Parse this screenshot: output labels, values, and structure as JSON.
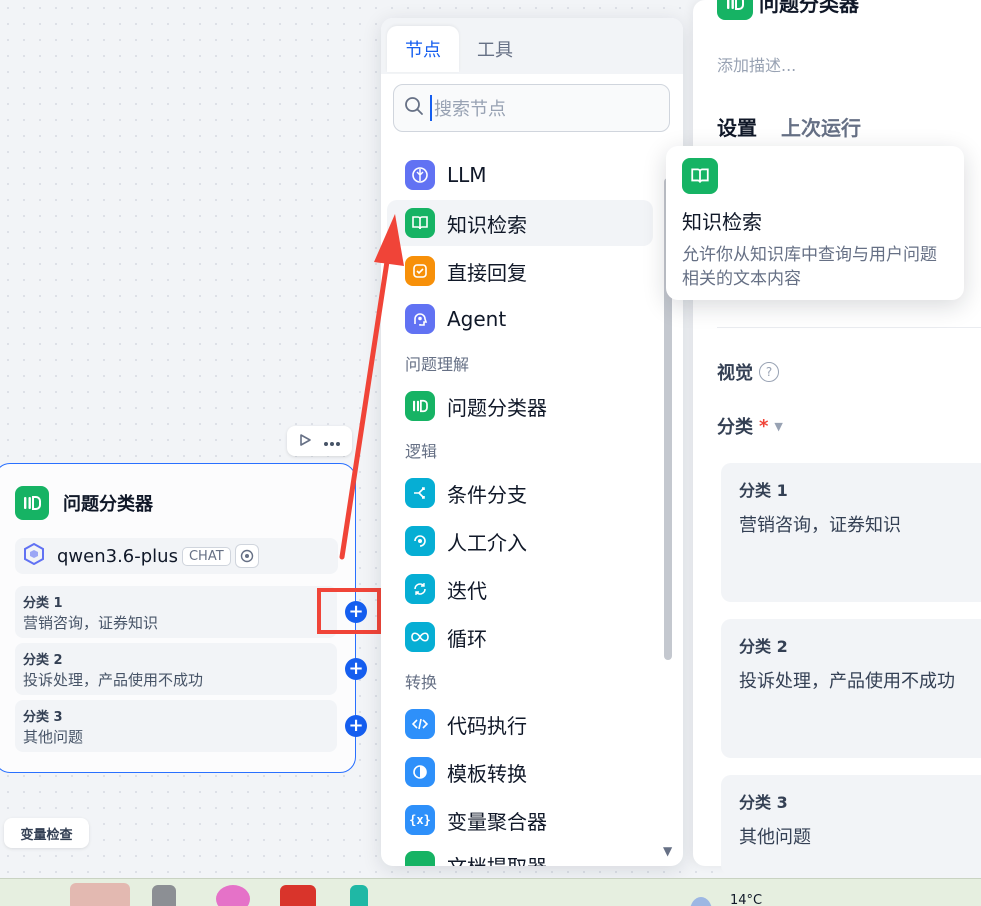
{
  "canvas": {
    "node_actions": {
      "run_icon": "play-icon",
      "more_icon": "more-icon"
    },
    "node": {
      "title": "问题分类器",
      "model": {
        "name": "qwen3.6-plus",
        "mode_badge": "CHAT",
        "vision_icon": "vision-icon"
      },
      "classes": [
        {
          "title": "分类 1",
          "desc": "营销咨询，证券知识"
        },
        {
          "title": "分类 2",
          "desc": "投诉处理，产品使用不成功"
        },
        {
          "title": "分类 3",
          "desc": "其他问题"
        }
      ]
    },
    "variable_check_label": "变量检查"
  },
  "picker": {
    "tabs": [
      {
        "label": "节点",
        "active": true
      },
      {
        "label": "工具",
        "active": false
      }
    ],
    "search_placeholder": "搜索节点",
    "items": [
      {
        "label": "LLM",
        "icon": "llm-icon",
        "color": "#6172f3"
      },
      {
        "label": "知识检索",
        "icon": "book-icon",
        "color": "#16b364",
        "hover": true
      },
      {
        "label": "直接回复",
        "icon": "reply-icon",
        "color": "#f79009"
      },
      {
        "label": "Agent",
        "icon": "agent-icon",
        "color": "#6172f3"
      }
    ],
    "group_understand": "问题理解",
    "classifier_item": {
      "label": "问题分类器",
      "color": "#16b364"
    },
    "group_logic": "逻辑",
    "logic_items": [
      {
        "label": "条件分支",
        "color": "#06aed4"
      },
      {
        "label": "人工介入",
        "color": "#06aed4"
      },
      {
        "label": "迭代",
        "color": "#06aed4"
      },
      {
        "label": "循环",
        "color": "#06aed4"
      }
    ],
    "group_transform": "转换",
    "transform_items": [
      {
        "label": "代码执行",
        "color": "#2e90fa"
      },
      {
        "label": "模板转换",
        "color": "#2e90fa"
      },
      {
        "label": "变量聚合器",
        "color": "#2e90fa"
      },
      {
        "label": "文档提取器",
        "color": "#16b364"
      }
    ]
  },
  "tooltip": {
    "title": "知识检索",
    "desc": "允许你从知识库中查询与用户问题相关的文本内容"
  },
  "right_panel": {
    "title": "问题分类器",
    "desc_placeholder": "添加描述...",
    "tabs": [
      "设置",
      "上次运行"
    ],
    "vision_label": "视觉",
    "class_label": "分类",
    "classes": [
      {
        "title": "分类 1",
        "desc": "营销咨询，证券知识"
      },
      {
        "title": "分类 2",
        "desc": "投诉处理，产品使用不成功"
      },
      {
        "title": "分类 3",
        "desc": "其他问题"
      }
    ]
  },
  "taskbar": {
    "weather": "14°C"
  }
}
